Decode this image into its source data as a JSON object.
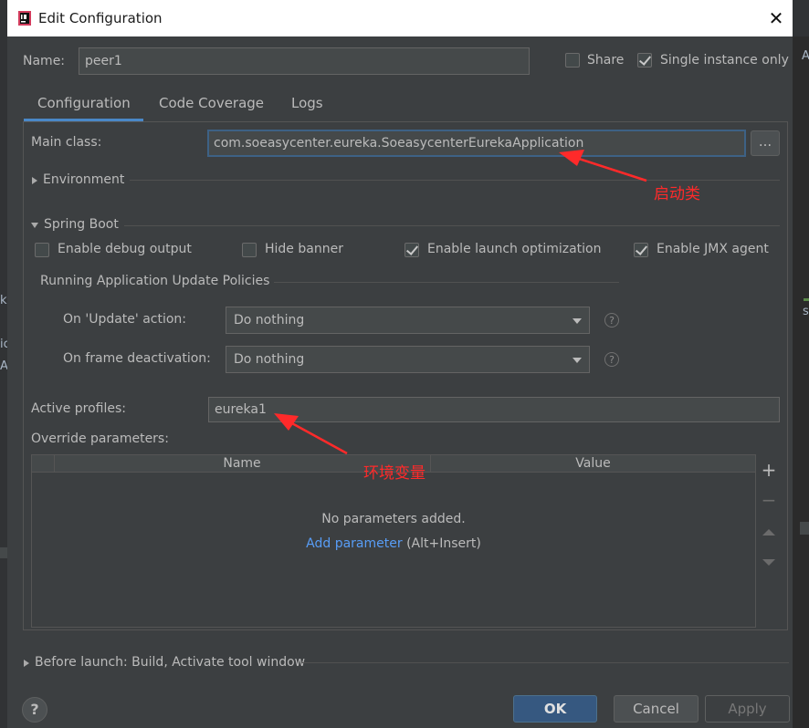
{
  "window": {
    "title": "Edit Configuration",
    "close_glyph": "✕"
  },
  "name_row": {
    "label": "Name:",
    "value": "peer1"
  },
  "share": {
    "label": "Share",
    "checked": false
  },
  "single_instance": {
    "label": "Single instance only",
    "checked": true
  },
  "tabs": [
    {
      "label": "Configuration",
      "active": true
    },
    {
      "label": "Code Coverage",
      "active": false
    },
    {
      "label": "Logs",
      "active": false
    }
  ],
  "main_class": {
    "label": "Main class:",
    "value": "com.soeasycenter.eureka.SoeasycenterEurekaApplication",
    "browse_label": "..."
  },
  "environment": {
    "label": "Environment"
  },
  "spring_boot": {
    "label": "Spring Boot"
  },
  "options": [
    {
      "label": "Enable debug output",
      "checked": false
    },
    {
      "label": "Hide banner",
      "checked": false
    },
    {
      "label": "Enable launch optimization",
      "checked": true
    },
    {
      "label": "Enable JMX agent",
      "checked": true
    }
  ],
  "policies": {
    "title": "Running Application Update Policies",
    "on_update": {
      "label": "On 'Update' action:",
      "value": "Do nothing"
    },
    "on_frame": {
      "label": "On frame deactivation:",
      "value": "Do nothing"
    }
  },
  "active_profiles": {
    "label": "Active profiles:",
    "value": "eureka1"
  },
  "override": {
    "label": "Override parameters:",
    "columns": [
      "Name",
      "Value"
    ],
    "empty_text": "No parameters added.",
    "add_link": "Add parameter",
    "add_hint": "(Alt+Insert)",
    "add_glyph": "+",
    "remove_glyph": "−"
  },
  "before_launch": {
    "label": "Before launch: Build, Activate tool window"
  },
  "buttons": {
    "help": "?",
    "ok": "OK",
    "cancel": "Cancel",
    "apply": "Apply"
  },
  "annotations": {
    "main_class_note": "启动类",
    "profiles_note": "环境变量",
    "color": "#ff2a2a"
  },
  "background_glyphs": [
    "ka",
    "ic",
    "A",
    "s",
    "A"
  ]
}
